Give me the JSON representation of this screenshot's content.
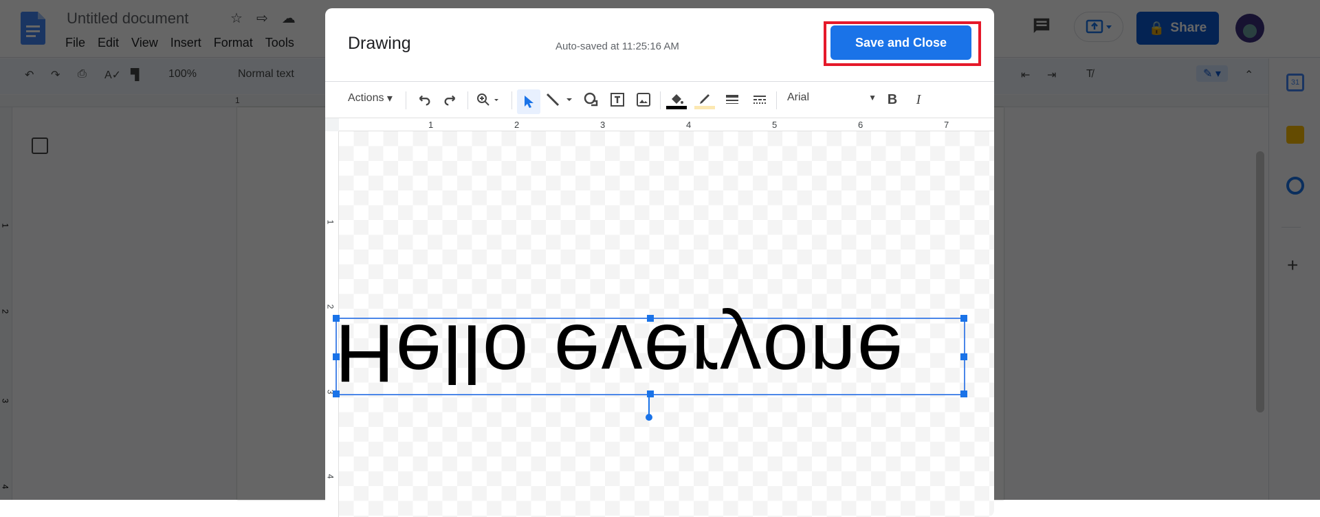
{
  "doc": {
    "title": "Untitled document",
    "menu": [
      "File",
      "Edit",
      "View",
      "Insert",
      "Format",
      "Tools"
    ],
    "toolbar": {
      "zoom": "100%",
      "style": "Normal text"
    },
    "share_label": "Share",
    "ruler_h": [
      "1"
    ],
    "ruler_v": [
      "1",
      "2",
      "3",
      "4"
    ]
  },
  "dialog": {
    "title": "Drawing",
    "autosave": "Auto-saved at 11:25:16 AM",
    "save_label": "Save and Close",
    "toolbar": {
      "actions_label": "Actions",
      "font": "Arial",
      "fill_color": "#000000",
      "line_color": "#fce8b2"
    },
    "ruler_h": [
      "1",
      "2",
      "3",
      "4",
      "5",
      "6",
      "7"
    ],
    "ruler_v": [
      "1",
      "2",
      "3",
      "4"
    ],
    "canvas_text": "Hello everyone",
    "canvas_text_flip": "vertical"
  },
  "colors": {
    "accent": "#1a73e8",
    "highlight": "#e5192a",
    "share": "#0b57d0"
  }
}
